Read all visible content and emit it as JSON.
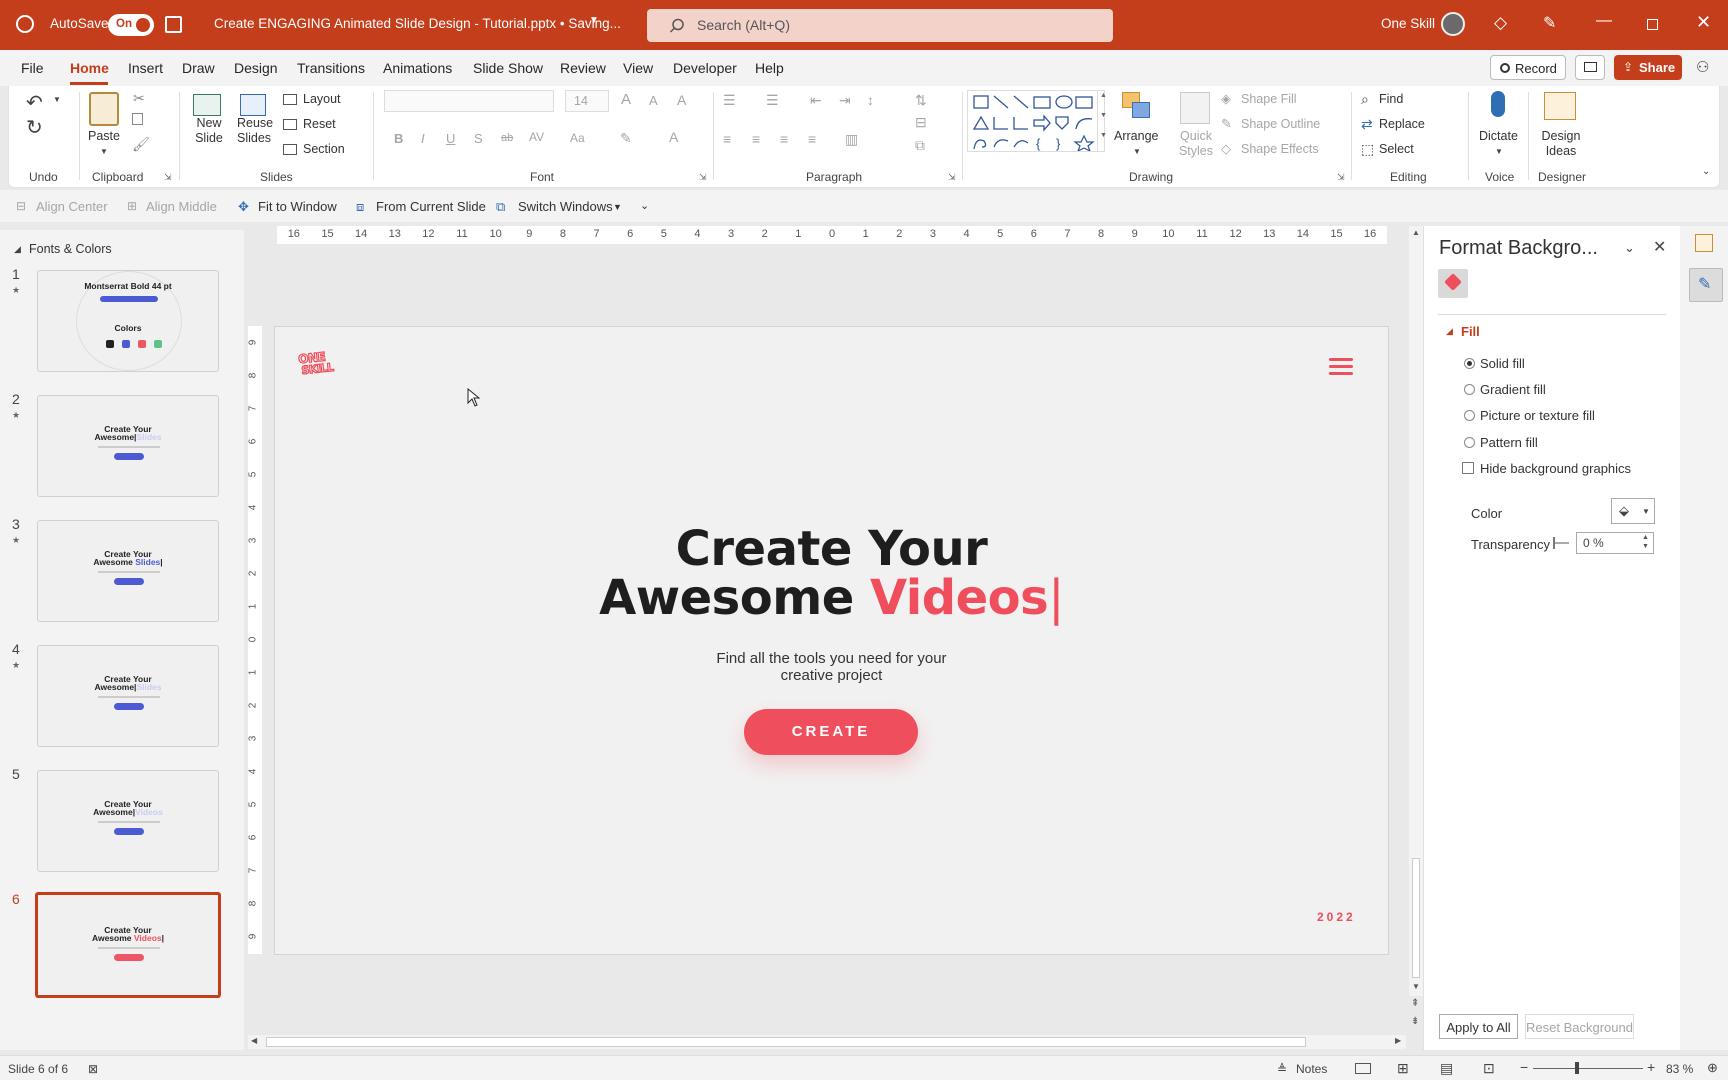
{
  "titlebar": {
    "autosave_label": "AutoSave",
    "autosave_state": "On",
    "document_title": "Create ENGAGING Animated Slide Design - Tutorial.pptx • Saving...",
    "search_placeholder": "Search (Alt+Q)",
    "user_name": "One Skill"
  },
  "menu": {
    "tabs": [
      "File",
      "Home",
      "Insert",
      "Draw",
      "Design",
      "Transitions",
      "Animations",
      "Slide Show",
      "Review",
      "View",
      "Developer",
      "Help"
    ],
    "active_tab": "Home",
    "record_label": "Record",
    "share_label": "Share"
  },
  "ribbon": {
    "undo_label": "Undo",
    "clipboard": {
      "label": "Clipboard",
      "paste": "Paste"
    },
    "slides": {
      "label": "Slides",
      "new_slide": "New Slide",
      "reuse_slides": "Reuse Slides",
      "layout": "Layout",
      "reset": "Reset",
      "section": "Section"
    },
    "font": {
      "label": "Font",
      "size": "14"
    },
    "paragraph": {
      "label": "Paragraph"
    },
    "drawing": {
      "label": "Drawing",
      "arrange": "Arrange",
      "quick_styles": "Quick Styles",
      "shape_fill": "Shape Fill",
      "shape_outline": "Shape Outline",
      "shape_effects": "Shape Effects"
    },
    "editing": {
      "label": "Editing",
      "find": "Find",
      "replace": "Replace",
      "select": "Select"
    },
    "voice": {
      "label": "Voice",
      "dictate": "Dictate"
    },
    "designer": {
      "label": "Designer",
      "design_ideas": "Design Ideas"
    }
  },
  "qat": {
    "align_center": "Align Center",
    "align_middle": "Align Middle",
    "fit_to_window": "Fit to Window",
    "from_current_slide": "From Current Slide",
    "switch_windows": "Switch Windows"
  },
  "thumbnails": {
    "section_name": "Fonts & Colors",
    "slides": [
      {
        "number": "1",
        "title": "Montserrat Bold 44 pt",
        "subtitle": "Colors"
      },
      {
        "number": "2",
        "line1": "Create Your",
        "line2": "Awesome",
        "word": "Slides"
      },
      {
        "number": "3",
        "line1": "Create Your",
        "line2": "Awesome",
        "word": "Slides"
      },
      {
        "number": "4",
        "line1": "Create Your",
        "line2": "Awesome",
        "word": "Slides"
      },
      {
        "number": "5",
        "line1": "Create Your",
        "line2": "Awesome",
        "word": "Videos"
      },
      {
        "number": "6",
        "line1": "Create Your",
        "line2": "Awesome",
        "word": "Videos"
      }
    ],
    "selected": "6"
  },
  "ruler": {
    "h_ticks": [
      "16",
      "15",
      "14",
      "13",
      "12",
      "11",
      "10",
      "9",
      "8",
      "7",
      "6",
      "5",
      "4",
      "3",
      "2",
      "1",
      "0",
      "1",
      "2",
      "3",
      "4",
      "5",
      "6",
      "7",
      "8",
      "9",
      "10",
      "11",
      "12",
      "13",
      "14",
      "15",
      "16"
    ],
    "v_ticks": [
      "9",
      "8",
      "7",
      "6",
      "5",
      "4",
      "3",
      "2",
      "1",
      "0",
      "1",
      "2",
      "3",
      "4",
      "5",
      "6",
      "7",
      "8",
      "9"
    ]
  },
  "slide": {
    "logo_line1": "ONE",
    "logo_line2": "SKILL",
    "heading_line1": "Create Your",
    "heading_line2_start": "Awesome ",
    "heading_highlight": "Videos",
    "cursor_char": "|",
    "subtitle_line1": "Find all the tools you need for your",
    "subtitle_line2": "creative project",
    "button_label": "CREATE",
    "year": "2022",
    "accent_color": "#ef4f5c",
    "heading_color": "#1e1e1e"
  },
  "format_pane": {
    "title": "Format Backgro...",
    "section": "Fill",
    "options": [
      "Solid fill",
      "Gradient fill",
      "Picture or texture fill",
      "Pattern fill"
    ],
    "selected_option": "Solid fill",
    "hide_graphics_label": "Hide background graphics",
    "color_label": "Color",
    "transparency_label": "Transparency",
    "transparency_value": "0 %",
    "apply_all": "Apply to All",
    "reset_background": "Reset Background"
  },
  "statusbar": {
    "slide_info": "Slide 6 of 6",
    "notes_label": "Notes",
    "zoom": "83 %"
  }
}
